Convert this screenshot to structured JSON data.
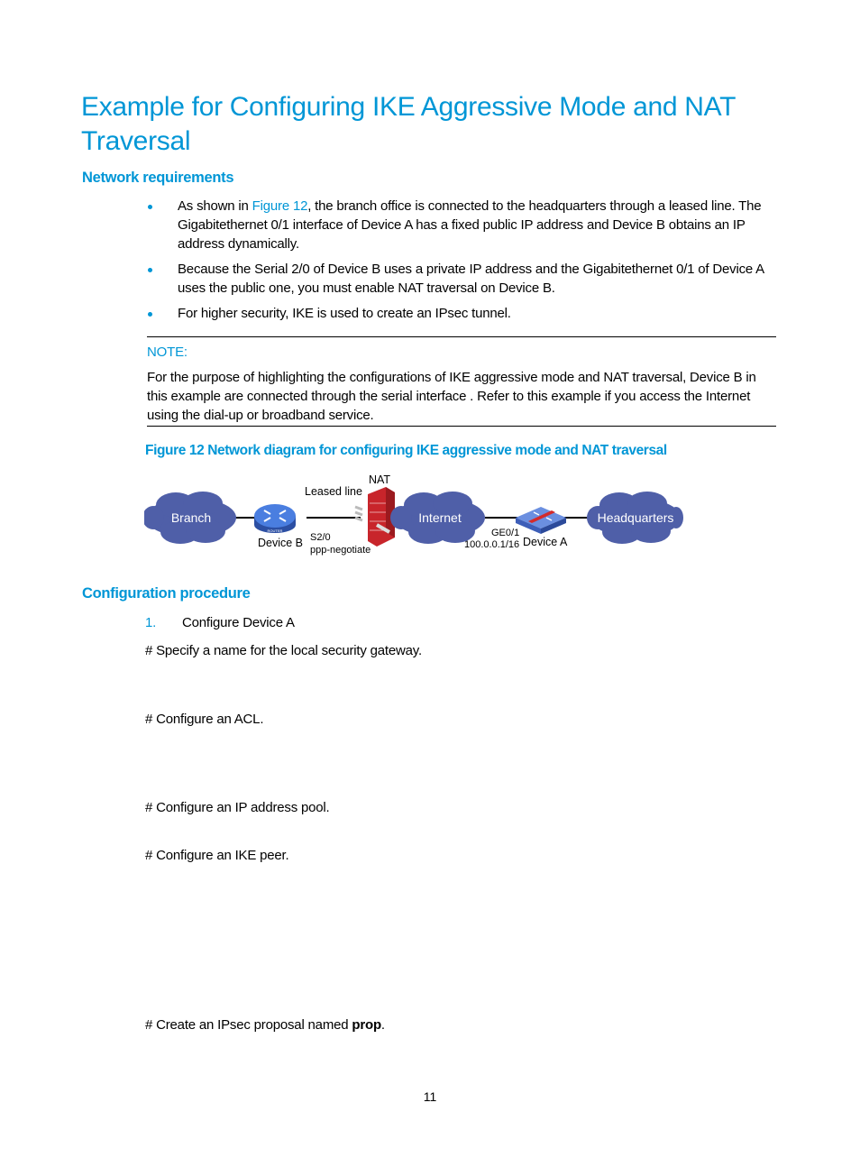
{
  "title": "Example for Configuring IKE Aggressive Mode and NAT Traversal",
  "network_requirements": {
    "heading": "Network requirements",
    "bullets": [
      {
        "prefix": "As shown in ",
        "link": "Figure 12",
        "suffix": ", the branch office is connected to the headquarters through a leased line. The Gigabitethernet 0/1 interface of Device A has a fixed public IP address and Device B obtains an IP address dynamically."
      },
      {
        "text": "Because the Serial 2/0 of Device B uses a private IP address and the Gigabitethernet 0/1 of Device A uses the public one, you must enable NAT traversal on Device B."
      },
      {
        "text": "For higher security, IKE is used to create an IPsec tunnel."
      }
    ]
  },
  "note": {
    "label": "NOTE:",
    "text": "For the purpose of highlighting the configurations of IKE aggressive mode and NAT traversal, Device B in this example are connected through the serial interface . Refer to this example if you access the Internet using the dial-up or broadband service."
  },
  "figure": {
    "caption": "Figure 12 Network diagram for configuring IKE aggressive mode and NAT traversal",
    "nodes": {
      "branch": "Branch",
      "internet": "Internet",
      "headquarters": "Headquarters",
      "device_b": "Device B",
      "device_a": "Device A",
      "nat": "NAT",
      "leased_line": "Leased line",
      "s20": "S2/0",
      "ppp": "ppp-negotiate",
      "ge01": "GE0/1",
      "ip": "100.0.0.1/16",
      "router_badge": "ROUTER"
    },
    "colors": {
      "cloud": "#4f5fa8",
      "router": "#3d6fd1",
      "firewall": "#c8252b",
      "switch": "#5b7fd4",
      "accent": "#0096d6"
    }
  },
  "configuration": {
    "heading": "Configuration procedure",
    "step_number": "1.",
    "step_text": "Configure Device A",
    "comments": [
      "# Specify a name for the local security gateway.",
      "# Configure an ACL.",
      "# Configure an IP address pool.",
      "# Configure an IKE peer."
    ],
    "last_comment_prefix": "# Create an IPsec proposal named ",
    "last_comment_bold": "prop",
    "last_comment_suffix": "."
  },
  "page_number": "11"
}
